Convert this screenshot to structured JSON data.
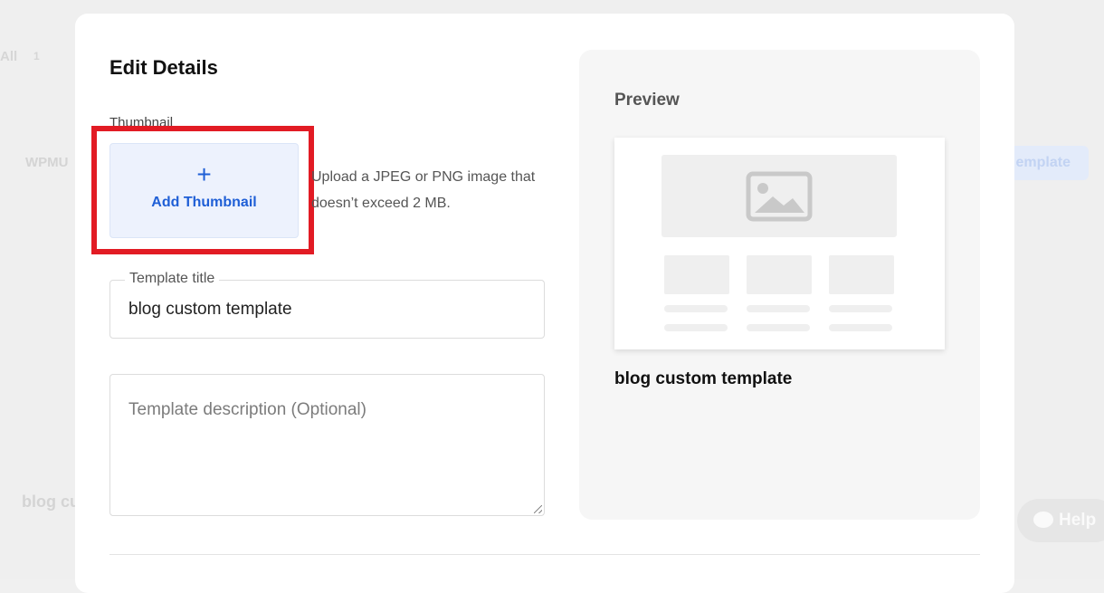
{
  "background": {
    "filter_all": "All",
    "filter_count": "1",
    "wpmu_label": "WPMU",
    "template_row_name": "blog cu",
    "create_button_label": "emplate",
    "help_label": "Help"
  },
  "modal": {
    "title": "Edit Details",
    "thumbnail": {
      "label": "Thumbnail",
      "plus_symbol": "+",
      "add_label": "Add Thumbnail",
      "hint": "Upload a JPEG or PNG image that doesn’t exceed 2 MB."
    },
    "template_title": {
      "label": "Template title",
      "value": "blog custom template"
    },
    "template_description": {
      "placeholder": "Template description (Optional)",
      "value": ""
    },
    "preview": {
      "label": "Preview",
      "template_name": "blog custom template"
    }
  },
  "colors": {
    "accent": "#1f5fd6",
    "highlight": "#e21b24",
    "thumbnail_bg": "#edf2fd"
  }
}
